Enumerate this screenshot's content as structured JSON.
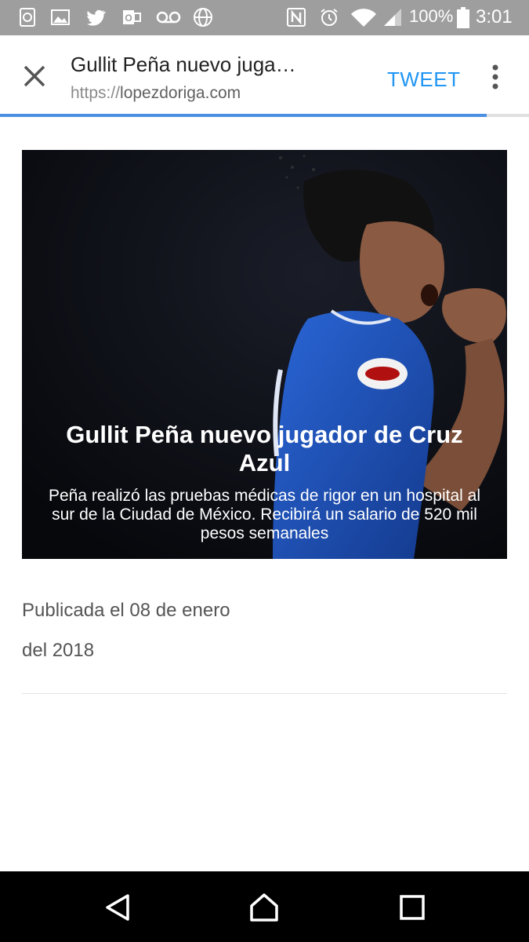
{
  "status_bar": {
    "battery": "100%",
    "time": "3:01",
    "left_icons": [
      "sync-icon",
      "image-icon",
      "twitter-icon",
      "outlook-icon",
      "voicemail-icon",
      "globe-icon"
    ],
    "right_icons": [
      "nfc-icon",
      "alarm-icon",
      "wifi-icon",
      "signal-icon",
      "battery-icon"
    ]
  },
  "toolbar": {
    "title": "Gullit Peña nuevo juga…",
    "url_scheme": "https://",
    "url_host": "lopezdoriga.com",
    "tweet_label": "TWEET",
    "load_progress": 0.92
  },
  "article": {
    "title": "Gullit Peña nuevo jugador de Cruz Azul",
    "description": "Peña realizó las pruebas médicas de rigor en un hospital al sur de la Ciudad de México. Recibirá un salario de 520 mil pesos semanales",
    "date_line1": "Publicada el 08 de enero",
    "date_line2": "del 2018"
  },
  "colors": {
    "status_bar": "#9e9e9e",
    "accent": "#2196f3",
    "progress": "#4a90e2",
    "jersey": "#1f4fb4"
  }
}
